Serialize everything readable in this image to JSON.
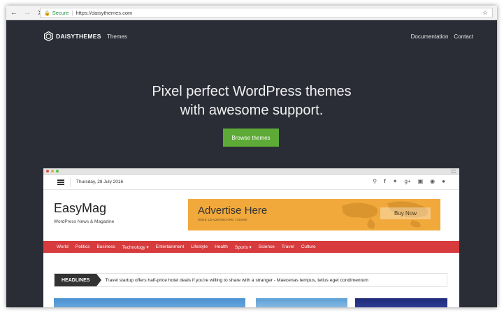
{
  "browser": {
    "secure_label": "Secure",
    "url": "https://daisythemes.com"
  },
  "site": {
    "logo_text": "DAISYTHEMES",
    "nav_themes": "Themes",
    "nav_documentation": "Documentation",
    "nav_contact": "Contact",
    "hero_line1": "Pixel perfect WordPress themes",
    "hero_line2": "with awesome support.",
    "cta_label": "Browse themes",
    "colors": {
      "background": "#2b2d36",
      "cta": "#5eaa36"
    }
  },
  "demo": {
    "date": "Thursday, 28 July 2016",
    "social_icons": [
      "search-icon",
      "facebook-icon",
      "twitter-icon",
      "googleplus-icon",
      "instagram-icon",
      "github-icon",
      "flickr-icon"
    ],
    "brand_name": "EasyMag",
    "brand_tagline": "WordPress News & Magazine",
    "ad": {
      "title": "Advertise Here",
      "subtitle": "WIDE LEADERBOARD 728X90",
      "button": "Buy Now"
    },
    "categories": [
      "World",
      "Politics",
      "Business",
      "Technology ▾",
      "Entertainment",
      "Lifestyle",
      "Health",
      "Sports ▾",
      "Science",
      "Travel",
      "Culture"
    ],
    "headlines_label": "HEADLINES",
    "headline_text": "Travel startup offers half-price hotel deals if you're willing to share with a stranger - Maecenas tempus, tellus eget condimentum",
    "colors": {
      "nav": "#d73b3e",
      "ad": "#f1a93b"
    }
  }
}
